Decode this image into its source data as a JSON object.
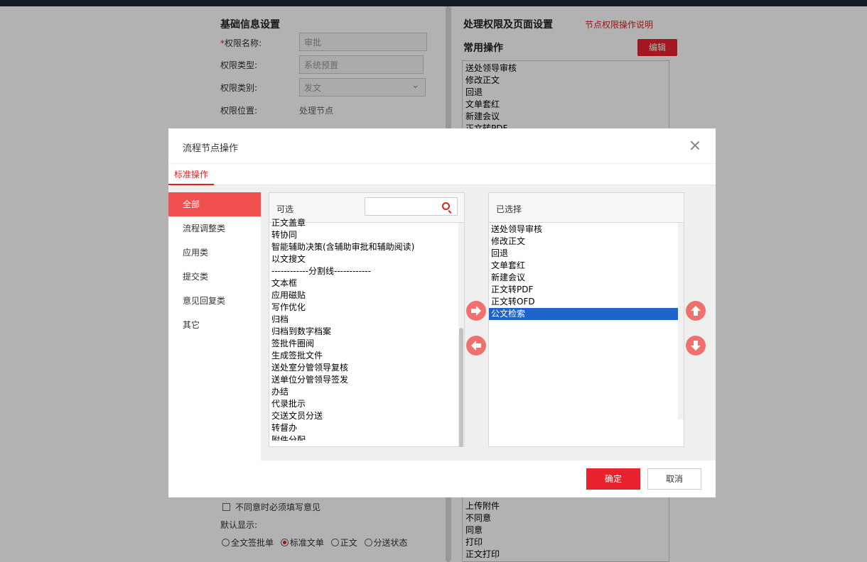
{
  "background": {
    "left_section_title": "基础信息设置",
    "perm_name_label": "权限名称:",
    "perm_name_required_mark": "*",
    "perm_name_value": "审批",
    "perm_type_label": "权限类型:",
    "perm_type_value": "系统预置",
    "perm_category_label": "权限类别:",
    "perm_category_value": "发文",
    "perm_location_label": "权限位置:",
    "perm_location_value": "处理节点",
    "right_section_title": "处理权限及页面设置",
    "help_link": "节点权限操作说明",
    "common_ops_title": "常用操作",
    "edit_button": "编辑",
    "common_ops_top": [
      "送处领导审核",
      "修改正文",
      "回退",
      "文单套红",
      "新建会议",
      "正文转PDF"
    ],
    "common_ops_bottom": [
      "上传附件",
      "不同意",
      "同意",
      "打印",
      "正文打印"
    ],
    "disagree_checkbox_label": "不同意时必须填写意见",
    "default_display_label": "默认显示:",
    "display_options": [
      {
        "label": "全文签批单",
        "checked": false
      },
      {
        "label": "标准文单",
        "checked": true
      },
      {
        "label": "正文",
        "checked": false
      },
      {
        "label": "分送状态",
        "checked": false
      }
    ]
  },
  "modal": {
    "title": "流程节点操作",
    "tab": "标准操作",
    "categories": [
      "全部",
      "流程调整类",
      "应用类",
      "提交类",
      "意见回复类",
      "其它"
    ],
    "active_category": 0,
    "available": {
      "header": "可选",
      "search_placeholder": "",
      "items": [
        "正文盖章",
        "转协同",
        "智能辅助决策(含辅助审批和辅助阅读)",
        "以文搜文",
        "------------分割线------------",
        "文本框",
        "应用磁贴",
        "写作优化",
        "归档",
        "归档到数字档案",
        "签批件圈阅",
        "生成签批文件",
        "送处室分管领导复核",
        "送单位分管领导签发",
        "办结",
        "代录批示",
        "交送文员分送",
        "转督办",
        "附件分配"
      ]
    },
    "selected": {
      "header": "已选择",
      "items": [
        "送处领导审核",
        "修改正文",
        "回退",
        "文单套红",
        "新建会议",
        "正文转PDF",
        "正文转OFD",
        "公文检索"
      ],
      "highlighted_index": 7
    },
    "ok_button": "确定",
    "cancel_button": "取消"
  },
  "colors": {
    "accent": "#e8222f",
    "selection": "#1e64c8",
    "arrow_button": "#f07070"
  }
}
